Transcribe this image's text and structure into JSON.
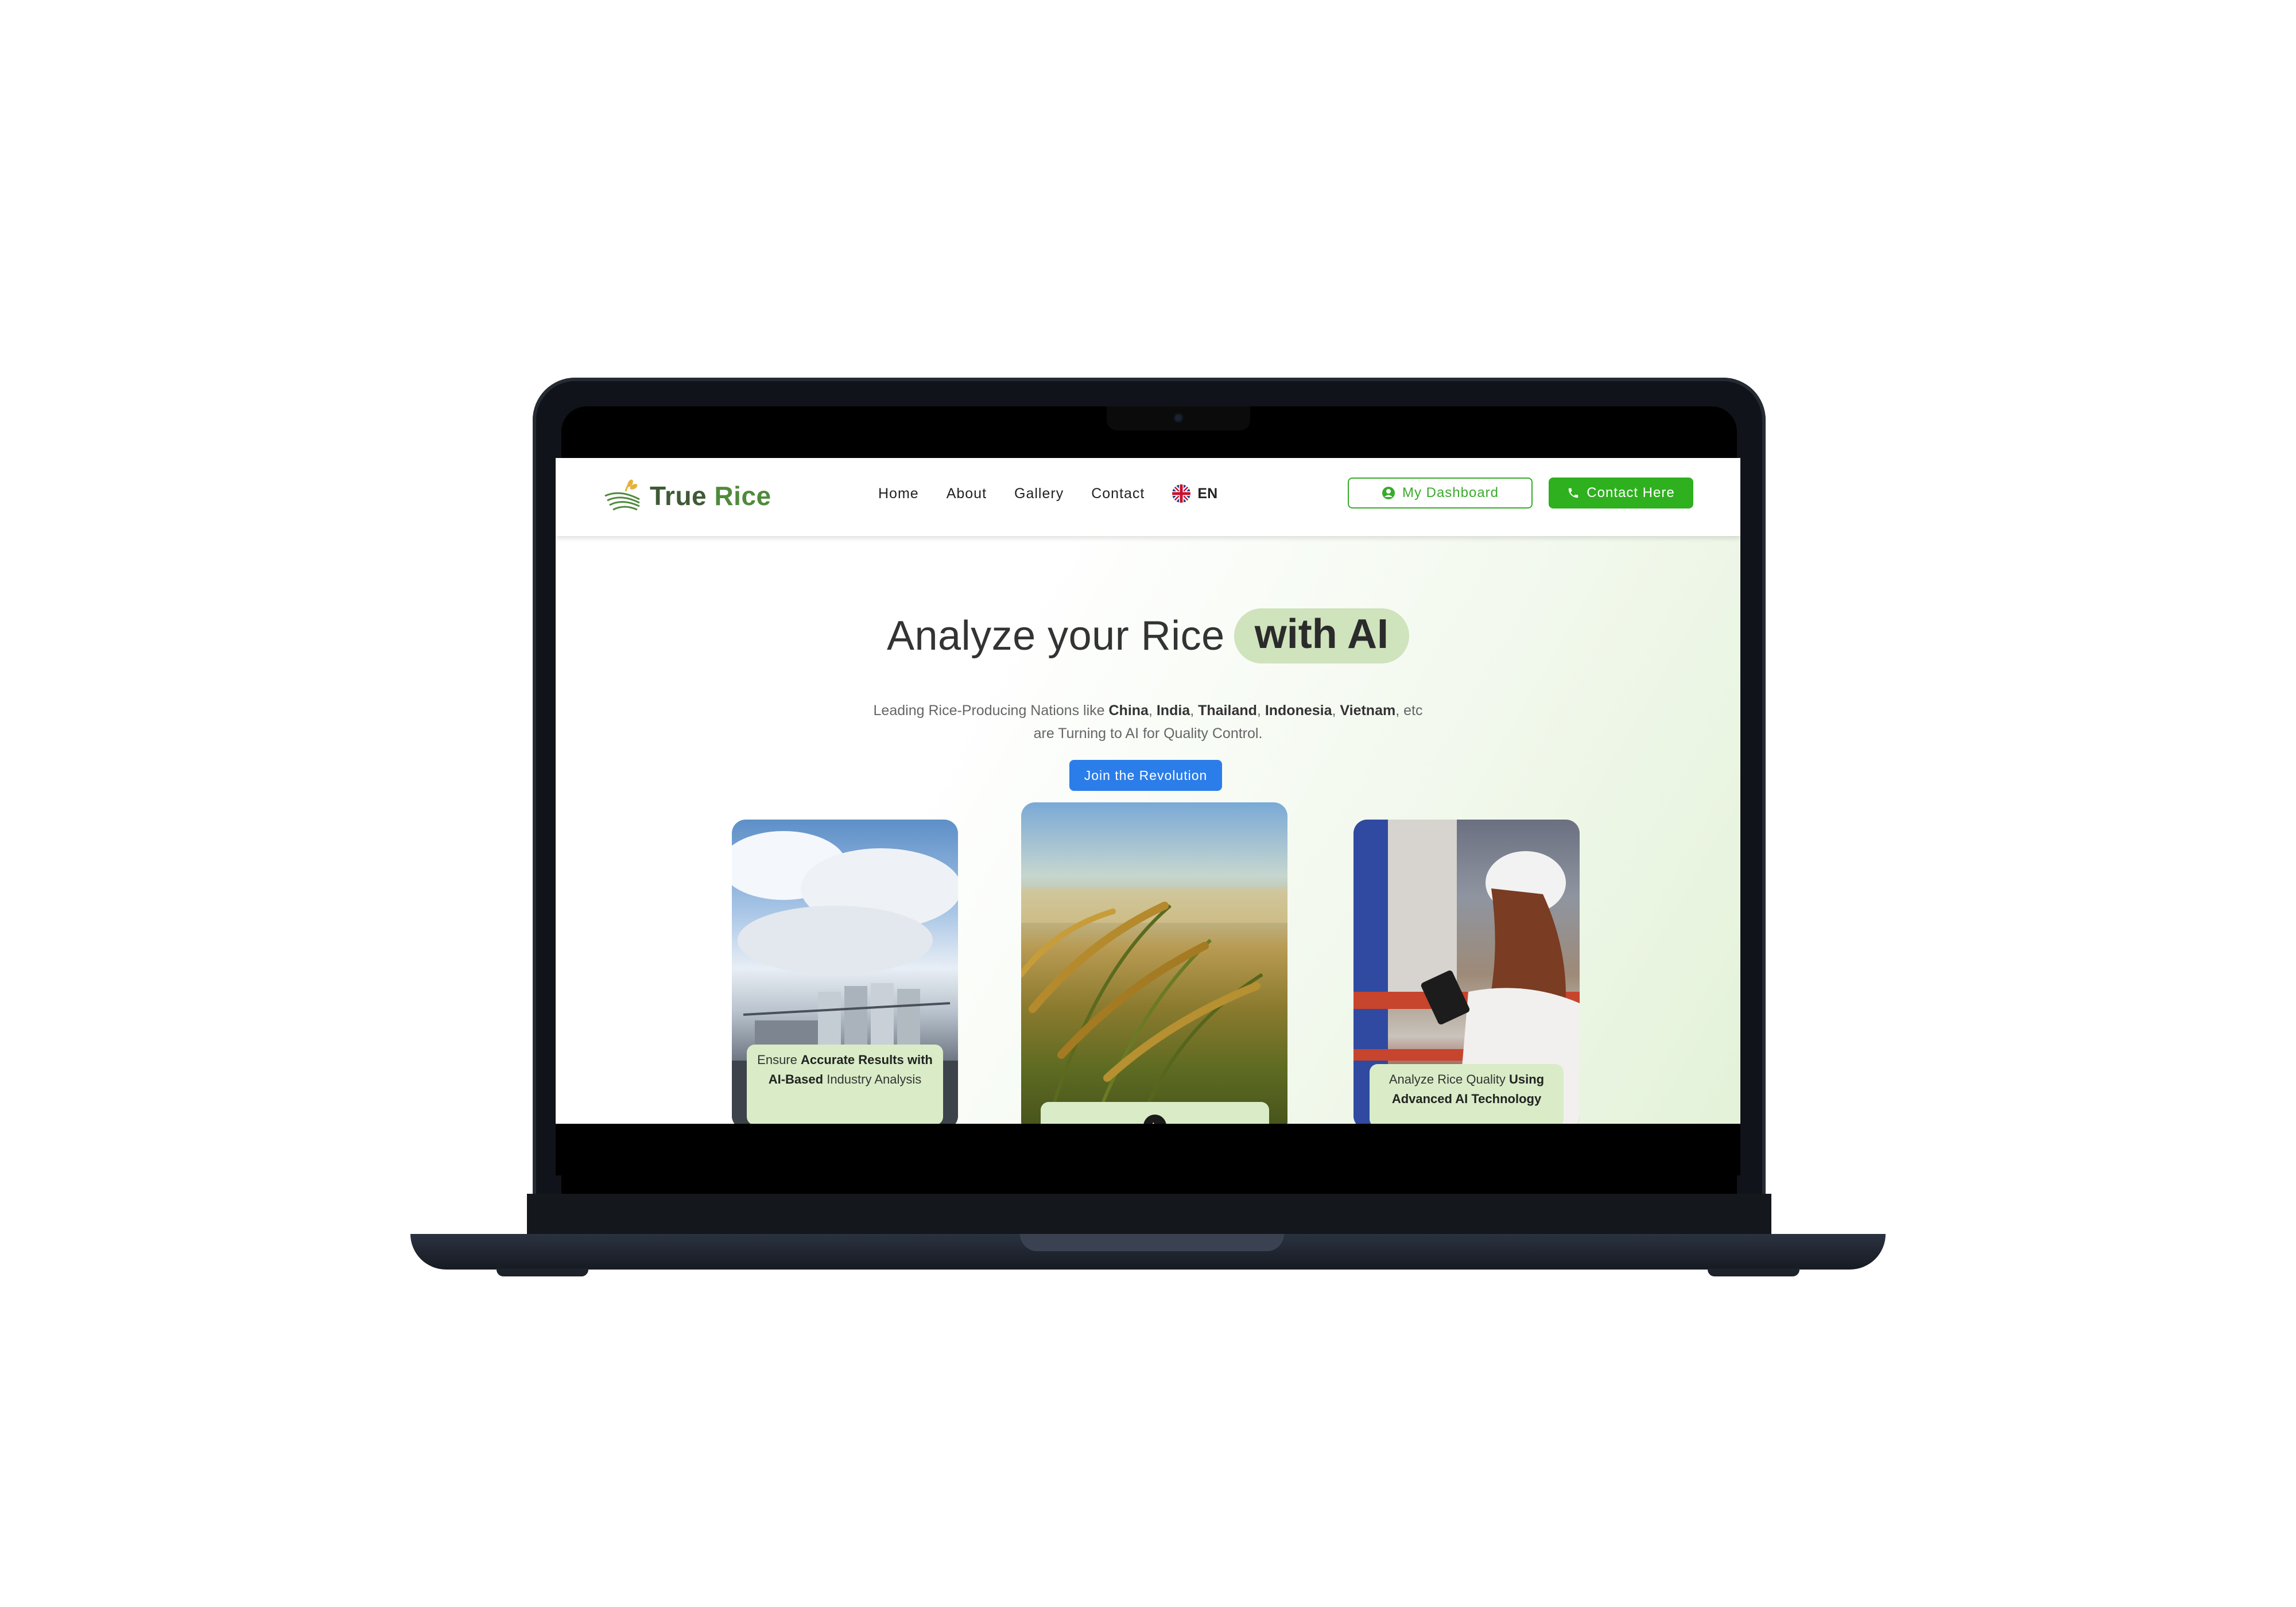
{
  "brand": {
    "name_part1": "True",
    "name_part2": "Rice"
  },
  "nav": {
    "links": [
      "Home",
      "About",
      "Gallery",
      "Contact"
    ],
    "language": "EN"
  },
  "buttons": {
    "dashboard": "My Dashboard",
    "contact": "Contact Here",
    "join": "Join the Revolution"
  },
  "hero": {
    "title_main": "Analyze your Rice",
    "title_highlight": "with AI",
    "subtitle_prefix": "Leading Rice-Producing Nations like",
    "countries": [
      "China",
      "India",
      "Thailand",
      "Indonesia",
      "Vietnam"
    ],
    "subtitle_etc": ", etc",
    "subtitle_line2": "are Turning to AI for Quality Control."
  },
  "cards": {
    "left": {
      "pre": "Ensure",
      "bold": "Accurate Results with AI-Based",
      "post": "Industry Analysis"
    },
    "right": {
      "pre": "Analyze Rice Quality",
      "bold": "Using Advanced AI Technology"
    }
  },
  "colors": {
    "primary_green": "#2fb01f",
    "brand_green": "#4f8a3c",
    "join_blue": "#2b7de9",
    "pill_green": "#cfe3bd",
    "caption_green": "#d9ecc7"
  },
  "icons": {
    "user": "user-circle-icon",
    "phone": "phone-icon",
    "flag": "uk-flag-icon",
    "logo": "rice-stalk-logo-icon",
    "floating": "mountain-badge-icon"
  }
}
